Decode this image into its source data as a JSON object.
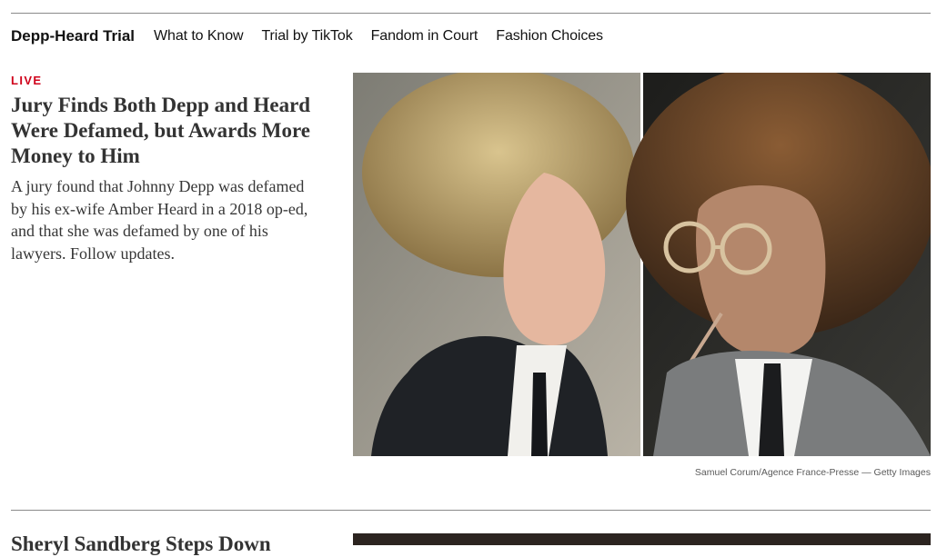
{
  "nav": {
    "section": "Depp-Heard Trial",
    "links": [
      "What to Know",
      "Trial by TikTok",
      "Fandom in Court",
      "Fashion Choices"
    ]
  },
  "story": {
    "live_label": "LIVE",
    "headline": "Jury Finds Both Depp and Heard Were Defamed, but Awards More Money to Him",
    "summary": "A jury found that Johnny Depp was defamed by his ex-wife Amber Heard in a 2018 op-ed, and that she was defamed by one of his lawyers. Follow updates.",
    "photo_credit": "Samuel Corum/Agence France-Presse — Getty Images"
  },
  "next_story": {
    "headline": "Sheryl Sandberg Steps Down"
  },
  "colors": {
    "live": "#d0021b",
    "text": "#121212",
    "headline": "#333333",
    "rule": "#8a8a8a"
  }
}
